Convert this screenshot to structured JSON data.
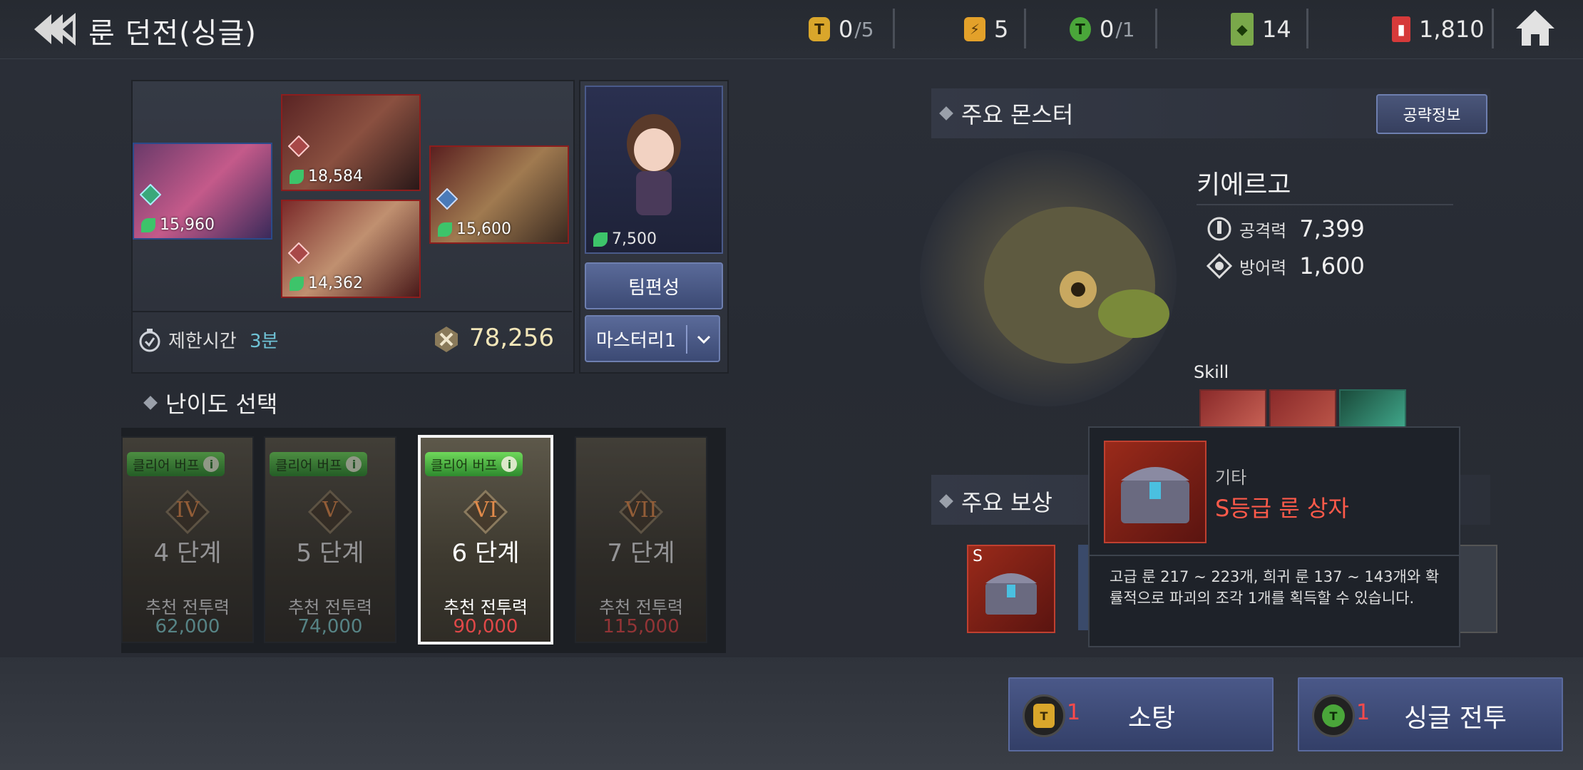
{
  "header": {
    "title": "룬 던전(싱글)",
    "resources": [
      {
        "icon": "gold-ticket-icon",
        "value": "0",
        "max": "/5",
        "color": "#d9a62b"
      },
      {
        "icon": "stamina-icon",
        "value": "5",
        "max": "",
        "color": "#e3a12a"
      },
      {
        "icon": "green-ticket-icon",
        "value": "0",
        "max": "/1",
        "color": "#4aa63a"
      },
      {
        "icon": "green-scroll-icon",
        "value": "14",
        "max": "",
        "color": "#7aa84a"
      },
      {
        "icon": "red-gem-icon",
        "value": "1,810",
        "max": "",
        "color": "#d63a3a"
      }
    ]
  },
  "team": {
    "heroes": [
      {
        "name": "pink-hair-hero",
        "cp": "15,960"
      },
      {
        "name": "white-hair-hero",
        "cp": "18,584"
      },
      {
        "name": "blonde-girl-hero",
        "cp": "14,362"
      },
      {
        "name": "knight-hero",
        "cp": "15,600"
      }
    ],
    "pet": {
      "cp": "7,500"
    },
    "time_limit_label": "제한시간",
    "time_limit_value": "3분",
    "total_power": "78,256",
    "team_edit_label": "팀편성",
    "mastery_label": "마스터리1"
  },
  "difficulty": {
    "title": "난이도 선택",
    "badge_label": "클리어 버프",
    "rec_label": "추천 전투력",
    "stages": [
      {
        "roman": "IV",
        "label": "4 단계",
        "rec": "62,000",
        "rec_color": "#7fc7c7",
        "selected": false
      },
      {
        "roman": "V",
        "label": "5 단계",
        "rec": "74,000",
        "rec_color": "#7fc7c7",
        "selected": false
      },
      {
        "roman": "VI",
        "label": "6 단계",
        "rec": "90,000",
        "rec_color": "#e04848",
        "selected": true
      },
      {
        "roman": "VII",
        "label": "7 단계",
        "rec": "115,000",
        "rec_color": "#e04848",
        "selected": false
      }
    ]
  },
  "monster": {
    "section_title": "주요 몬스터",
    "strategy_button": "공략정보",
    "name": "키에르고",
    "attack_label": "공격력",
    "attack_value": "7,399",
    "defense_label": "방어력",
    "defense_value": "1,600",
    "skill_label": "Skill"
  },
  "rewards": {
    "section_title": "주요 보상",
    "first_grade": "S"
  },
  "tooltip": {
    "category": "기타",
    "item_name": "S등급 룬 상자",
    "description": "고급 룬 217 ~ 223개, 희귀 룬 137 ~ 143개와 확률적으로 파괴의 조각 1개를 획득할 수 있습니다."
  },
  "actions": {
    "sweep": {
      "cost": "1",
      "label": "소탕"
    },
    "battle": {
      "cost": "1",
      "label": "싱글 전투"
    }
  }
}
